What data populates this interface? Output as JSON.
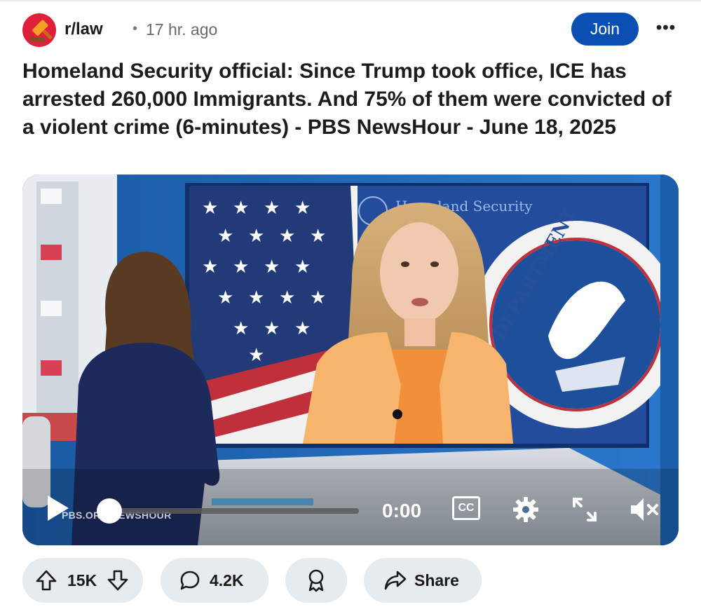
{
  "post": {
    "subreddit": "r/law",
    "separator": "•",
    "age": "17 hr. ago",
    "join_label": "Join",
    "more_label": "•••",
    "title": "Homeland Security official: Since Trump took office, ICE has arrested 260,000 Immigrants. And 75% of them were convicted of a violent crime (6-minutes) - PBS NewsHour - June 18, 2025"
  },
  "video": {
    "time": "0:00",
    "cc_label": "CC",
    "watermark": "PBS.ORG/NEWSHOUR",
    "backdrop_text": "Homeland Security",
    "seal_text": "DEPARTMENT",
    "progress": 0.0
  },
  "actions": {
    "upvotes": "15K",
    "comments": "4.2K",
    "share_label": "Share"
  },
  "icons": [
    "gavel-icon",
    "play-icon",
    "cc-icon",
    "gear-icon",
    "expand-icon",
    "mute-icon",
    "upvote-icon",
    "downvote-icon",
    "comment-icon",
    "award-icon",
    "share-icon"
  ],
  "colors": {
    "join_button": "#0b4fb3",
    "pill_background": "#e5ebee",
    "avatar": "#e0203a",
    "studio_blue": "#1e66b8",
    "jacket_orange": "#f6b46c"
  }
}
